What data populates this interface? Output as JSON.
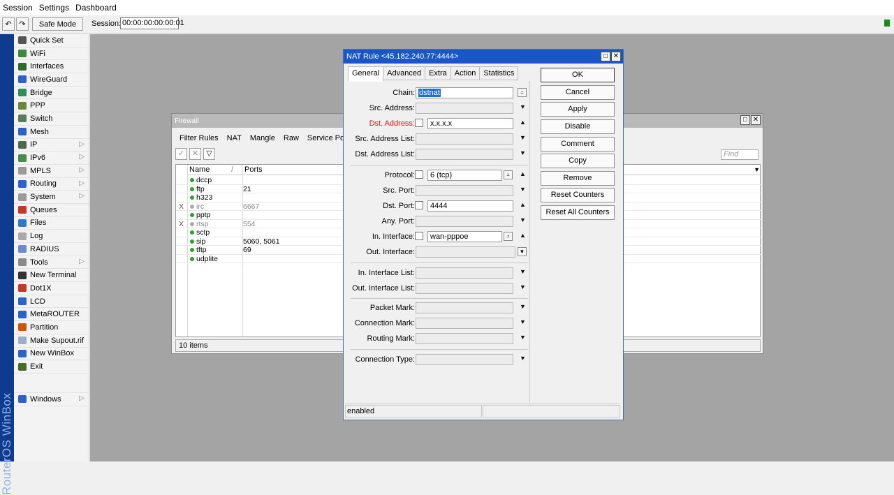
{
  "menubar": {
    "items": [
      "Session",
      "Settings",
      "Dashboard"
    ]
  },
  "toolbar": {
    "undo_icon": "undo-icon",
    "redo_icon": "redo-icon",
    "safe_mode_label": "Safe Mode",
    "session_label": "Session:",
    "session_value": "00:00:00:00:00:01",
    "status_color": "#1a8a1a"
  },
  "brand": {
    "text": "RouterOS WinBox"
  },
  "sidebar": {
    "items": [
      {
        "label": "Quick Set",
        "icon": "wand-icon",
        "color": "#555555",
        "arrow": ""
      },
      {
        "label": "WiFi",
        "icon": "wifi-icon",
        "color": "#3a8a3a",
        "arrow": ""
      },
      {
        "label": "Interfaces",
        "icon": "interfaces-icon",
        "color": "#2e6a2e",
        "arrow": ""
      },
      {
        "label": "WireGuard",
        "icon": "wireguard-icon",
        "color": "#2b63c9",
        "arrow": ""
      },
      {
        "label": "Bridge",
        "icon": "bridge-icon",
        "color": "#2b8f5a",
        "arrow": ""
      },
      {
        "label": "PPP",
        "icon": "ppp-icon",
        "color": "#6a8a3a",
        "arrow": ""
      },
      {
        "label": "Switch",
        "icon": "switch-icon",
        "color": "#5b7b5b",
        "arrow": ""
      },
      {
        "label": "Mesh",
        "icon": "mesh-icon",
        "color": "#2b63c9",
        "arrow": ""
      },
      {
        "label": "IP",
        "icon": "ip-icon",
        "color": "#4a6a4a",
        "arrow": "▷"
      },
      {
        "label": "IPv6",
        "icon": "ipv6-icon",
        "color": "#4a8a4a",
        "arrow": "▷"
      },
      {
        "label": "MPLS",
        "icon": "mpls-icon",
        "color": "#9a9a9a",
        "arrow": "▷"
      },
      {
        "label": "Routing",
        "icon": "routing-icon",
        "color": "#2b63c9",
        "arrow": "▷"
      },
      {
        "label": "System",
        "icon": "system-icon",
        "color": "#9a9a9a",
        "arrow": "▷"
      },
      {
        "label": "Queues",
        "icon": "queues-icon",
        "color": "#c0392b",
        "arrow": ""
      },
      {
        "label": "Files",
        "icon": "files-icon",
        "color": "#2b7bd1",
        "arrow": ""
      },
      {
        "label": "Log",
        "icon": "log-icon",
        "color": "#a9a9a9",
        "arrow": ""
      },
      {
        "label": "RADIUS",
        "icon": "radius-icon",
        "color": "#6a8ac9",
        "arrow": ""
      },
      {
        "label": "Tools",
        "icon": "tools-icon",
        "color": "#8a8a8a",
        "arrow": "▷"
      },
      {
        "label": "New Terminal",
        "icon": "terminal-icon",
        "color": "#333333",
        "arrow": ""
      },
      {
        "label": "Dot1X",
        "icon": "dot1x-icon",
        "color": "#c0392b",
        "arrow": ""
      },
      {
        "label": "LCD",
        "icon": "lcd-icon",
        "color": "#2b63c9",
        "arrow": ""
      },
      {
        "label": "MetaROUTER",
        "icon": "metarouter-icon",
        "color": "#2b63c9",
        "arrow": ""
      },
      {
        "label": "Partition",
        "icon": "partition-icon",
        "color": "#d35400",
        "arrow": ""
      },
      {
        "label": "Make Supout.rif",
        "icon": "supout-icon",
        "color": "#9ab0c9",
        "arrow": ""
      },
      {
        "label": "New WinBox",
        "icon": "winbox-icon",
        "color": "#2b63c9",
        "arrow": ""
      },
      {
        "label": "Exit",
        "icon": "exit-icon",
        "color": "#4a6a2a",
        "arrow": ""
      }
    ],
    "windows": {
      "label": "Windows",
      "icon": "windows-icon",
      "color": "#2b63c9",
      "arrow": "▷"
    }
  },
  "firewall": {
    "title": "Firewall",
    "tabs": [
      "Filter Rules",
      "NAT",
      "Mangle",
      "Raw",
      "Service Ports"
    ],
    "find_placeholder": "Find",
    "columns": {
      "name": "Name",
      "ports": "Ports",
      "sort_mark": "/"
    },
    "rows": [
      {
        "mark": "",
        "name": "dccp",
        "ports": "",
        "enabled": true
      },
      {
        "mark": "",
        "name": "ftp",
        "ports": "21",
        "enabled": true
      },
      {
        "mark": "",
        "name": "h323",
        "ports": "",
        "enabled": true
      },
      {
        "mark": "X",
        "name": "irc",
        "ports": "6667",
        "enabled": false
      },
      {
        "mark": "",
        "name": "pptp",
        "ports": "",
        "enabled": true
      },
      {
        "mark": "X",
        "name": "rtsp",
        "ports": "554",
        "enabled": false
      },
      {
        "mark": "",
        "name": "sctp",
        "ports": "",
        "enabled": true
      },
      {
        "mark": "",
        "name": "sip",
        "ports": "5060, 5061",
        "enabled": true
      },
      {
        "mark": "",
        "name": "tftp",
        "ports": "69",
        "enabled": true
      },
      {
        "mark": "",
        "name": "udplite",
        "ports": "",
        "enabled": true
      }
    ],
    "status": "10 items"
  },
  "nat": {
    "title": "NAT Rule <45.182.240.77:4444>",
    "tabs": [
      "General",
      "Advanced",
      "Extra",
      "Action",
      "Statistics"
    ],
    "fields": {
      "chain": {
        "label": "Chain:",
        "value": "dstnat"
      },
      "src_address": {
        "label": "Src. Address:",
        "value": ""
      },
      "dst_address": {
        "label": "Dst. Address:",
        "value": "x.x.x.x"
      },
      "src_address_list": {
        "label": "Src. Address List:",
        "value": ""
      },
      "dst_address_list": {
        "label": "Dst. Address List:",
        "value": ""
      },
      "protocol": {
        "label": "Protocol:",
        "value": "6 (tcp)"
      },
      "src_port": {
        "label": "Src. Port:",
        "value": ""
      },
      "dst_port": {
        "label": "Dst. Port:",
        "value": "4444"
      },
      "any_port": {
        "label": "Any. Port:",
        "value": ""
      },
      "in_interface": {
        "label": "In. Interface:",
        "value": "wan-pppoe"
      },
      "out_interface": {
        "label": "Out. Interface:",
        "value": ""
      },
      "in_interface_list": {
        "label": "In. Interface List:",
        "value": ""
      },
      "out_interface_list": {
        "label": "Out. Interface List:",
        "value": ""
      },
      "packet_mark": {
        "label": "Packet Mark:",
        "value": ""
      },
      "connection_mark": {
        "label": "Connection Mark:",
        "value": ""
      },
      "routing_mark": {
        "label": "Routing Mark:",
        "value": ""
      },
      "connection_type": {
        "label": "Connection Type:",
        "value": ""
      }
    },
    "buttons": {
      "ok": "OK",
      "cancel": "Cancel",
      "apply": "Apply",
      "disable": "Disable",
      "comment": "Comment",
      "copy": "Copy",
      "remove": "Remove",
      "reset_counters": "Reset Counters",
      "reset_all_counters": "Reset All Counters"
    },
    "status": "enabled"
  }
}
